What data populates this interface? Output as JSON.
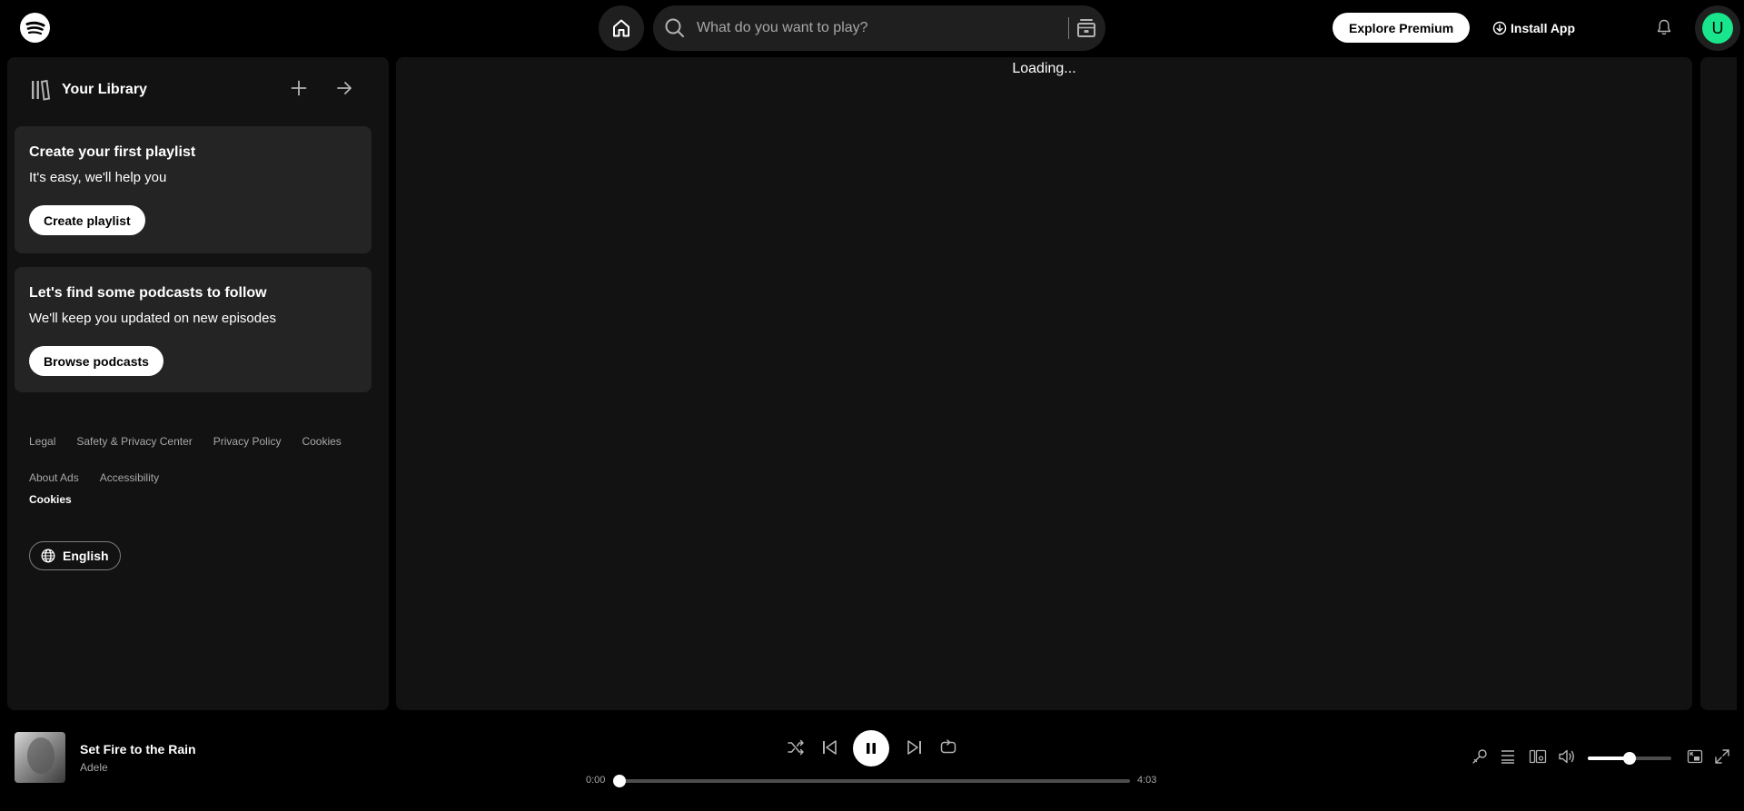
{
  "topbar": {
    "logo_icon": "spotify-logo",
    "home_icon": "home-icon",
    "search_placeholder": "What do you want to play?",
    "browse_icon": "browse-icon",
    "premium_label": "Explore Premium",
    "install_label": "Install App",
    "bell_icon": "bell-icon",
    "avatar_letter": "U",
    "avatar_color": "#19e68c"
  },
  "sidebar": {
    "library_title": "Your Library",
    "create_icon": "plus-icon",
    "expand_icon": "arrow-right-icon",
    "cards": [
      {
        "title": "Create your first playlist",
        "subtitle": "It's easy, we'll help you",
        "button": "Create playlist"
      },
      {
        "title": "Let's find some podcasts to follow",
        "subtitle": "We'll keep you updated on new episodes",
        "button": "Browse podcasts"
      }
    ],
    "footer_row1": [
      "Legal",
      "Safety & Privacy Center",
      "Privacy Policy",
      "Cookies"
    ],
    "footer_row2": [
      "About Ads",
      "Accessibility"
    ],
    "footer_cookies": "Cookies",
    "language": "English"
  },
  "main": {
    "status": "Loading..."
  },
  "player": {
    "track_title": "Set Fire to the Rain",
    "artist": "Adele",
    "time_elapsed": "0:00",
    "time_total": "4:03",
    "progress_fraction": 0.0,
    "volume_fraction": 0.5,
    "state": "playing"
  },
  "colors": {
    "background": "#000000",
    "panel": "#121212",
    "card": "#242424",
    "accent": "#19e68c"
  }
}
